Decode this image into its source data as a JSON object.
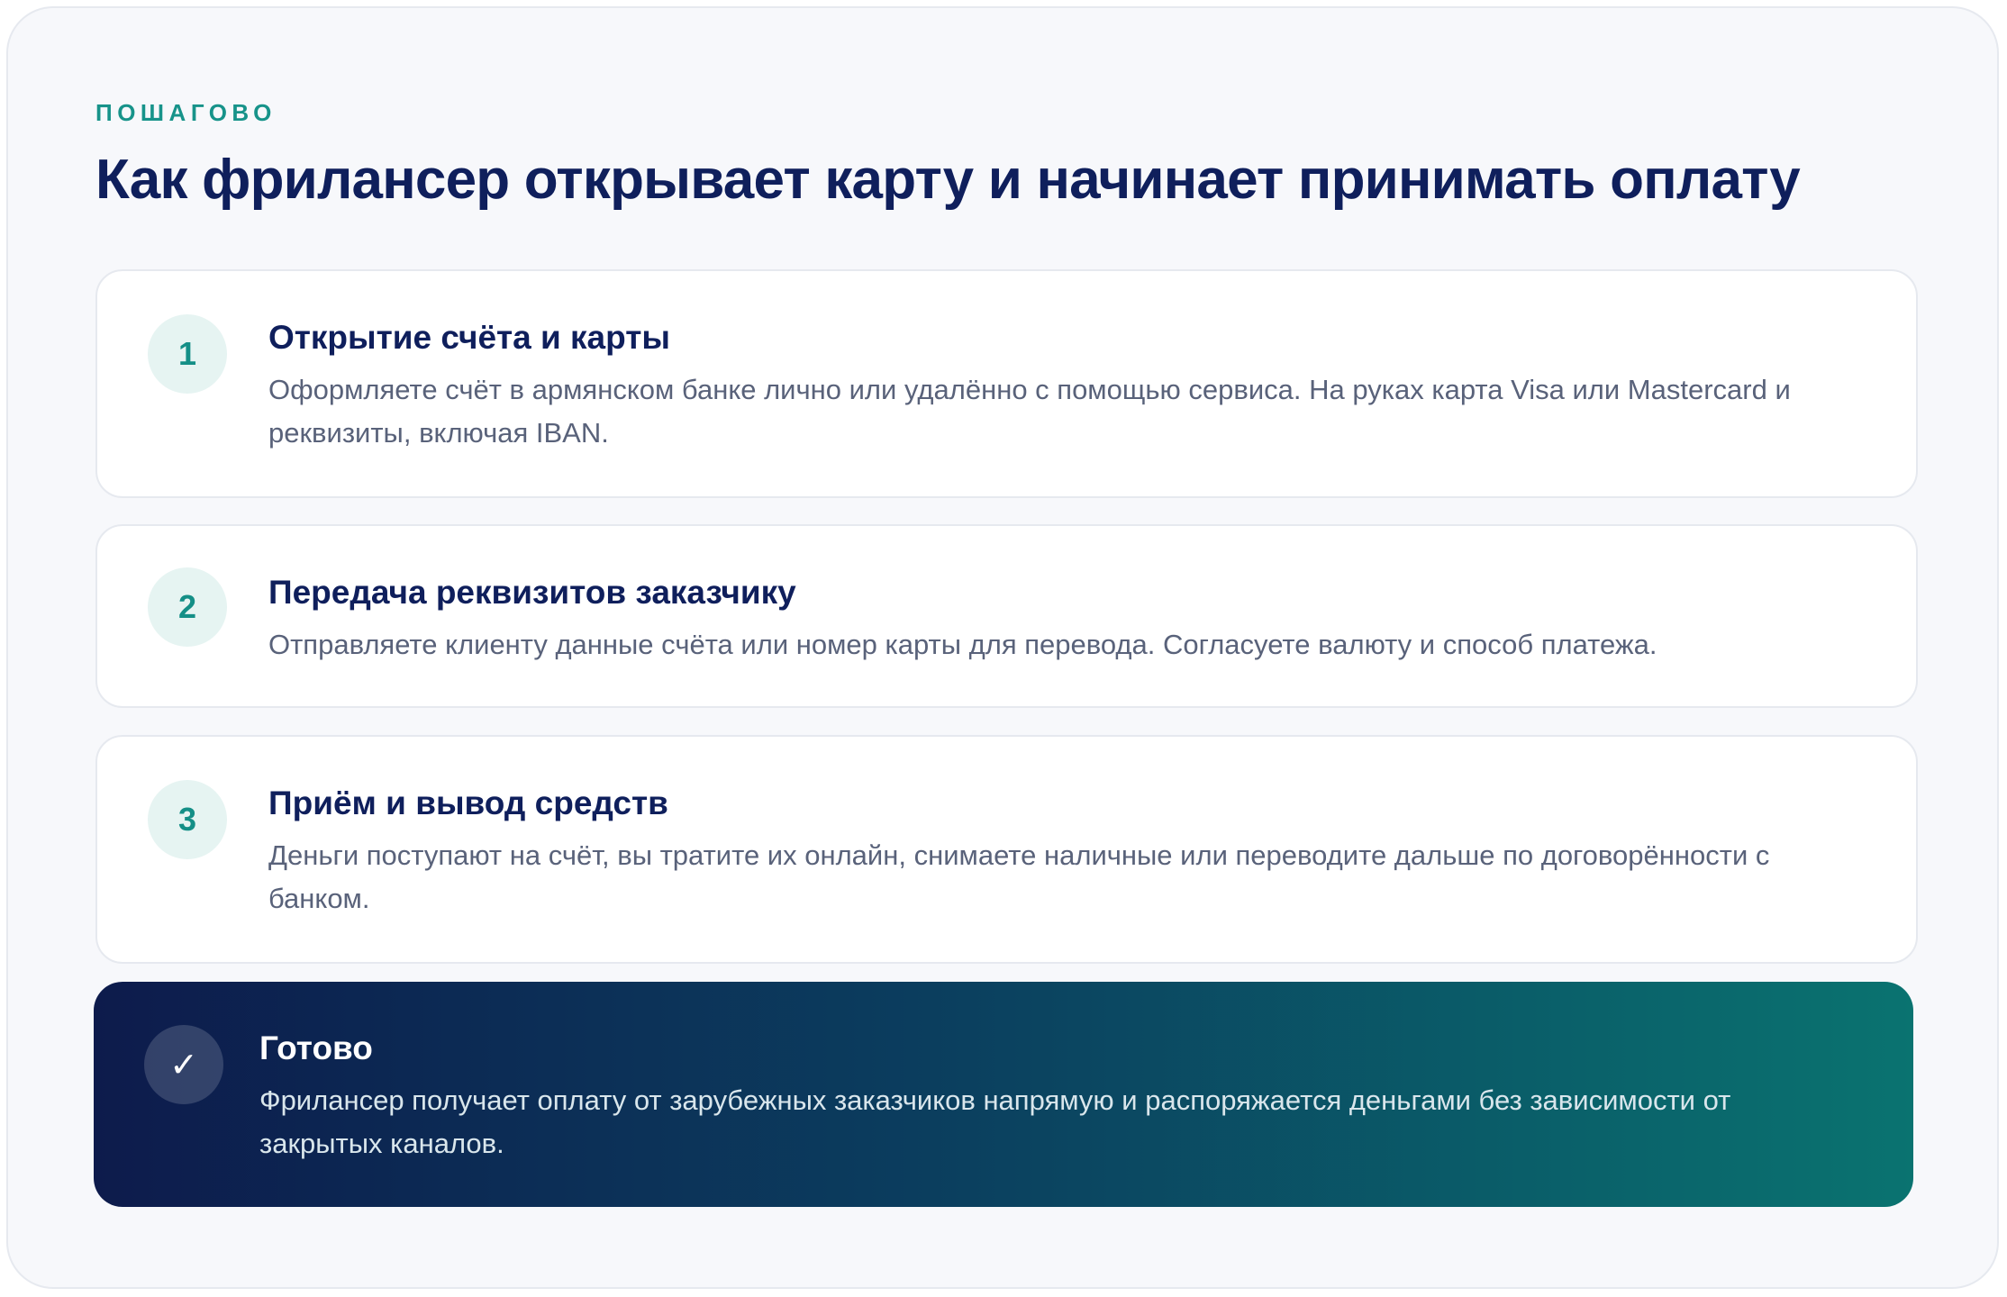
{
  "section": {
    "eyebrow": "ПОШАГОВО",
    "title": "Как фрилансер открывает карту и начинает принимать оплату"
  },
  "steps": [
    {
      "number": "1",
      "title": "Открытие счёта и карты",
      "description": "Оформляете счёт в армянском банке лично или удалённо с помощью сервиса. На руках карта Visa или Mastercard и реквизиты, включая IBAN."
    },
    {
      "number": "2",
      "title": "Передача реквизитов заказчику",
      "description": "Отправляете клиенту данные счёта или номер карты для перевода. Согласуете валюту и способ платежа."
    },
    {
      "number": "3",
      "title": "Приём и вывод средств",
      "description": "Деньги поступают на счёт, вы тратите их онлайн, снимаете наличные или переводите дальше по договорённости с банком."
    }
  ],
  "result": {
    "icon": "check-icon",
    "title": "Готово",
    "description": "Фрилансер получает оплату от зарубежных заказчиков напрямую и распоряжается деньгами без зависимости от закрытых каналов."
  },
  "colors": {
    "accent": "#17938a",
    "heading": "#0f1f5c",
    "body_text": "#59627a",
    "gradient_start": "#0d1b4c",
    "gradient_end": "#0a7370"
  }
}
